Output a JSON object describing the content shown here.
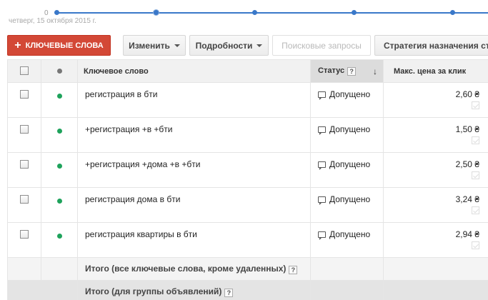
{
  "timeline": {
    "zero_label": "0",
    "date_label": "четверг, 15 октября 2015 г.",
    "accent": "#3a78c9"
  },
  "toolbar": {
    "add_keywords_label": "КЛЮЧЕВЫЕ СЛОВА",
    "add_icon": "plus-icon",
    "edit_label": "Изменить",
    "details_label": "Подробности",
    "search_queries_label": "Поисковые запросы",
    "strategy_label": "Стратегия назначения ставок"
  },
  "table": {
    "headers": {
      "keyword": "Ключевое слово",
      "status": "Статус",
      "max_cpc": "Макс. цена за клик"
    },
    "rows": [
      {
        "keyword": "регистрация в бти",
        "status": "Допущено",
        "price": "2,60 ₴"
      },
      {
        "keyword": "+регистрация +в +бти",
        "status": "Допущено",
        "price": "1,50 ₴"
      },
      {
        "keyword": "+регистрация +дома +в +бти",
        "status": "Допущено",
        "price": "2,50 ₴"
      },
      {
        "keyword": "регистрация дома в бти",
        "status": "Допущено",
        "price": "3,24 ₴"
      },
      {
        "keyword": "регистрация квартиры в бти",
        "status": "Допущено",
        "price": "2,94 ₴"
      }
    ],
    "total_all": "Итого (все ключевые слова, кроме удаленных)",
    "total_group": "Итого (для группы объявлений)",
    "help_glyph": "?",
    "status_color": "#1ea25b"
  }
}
